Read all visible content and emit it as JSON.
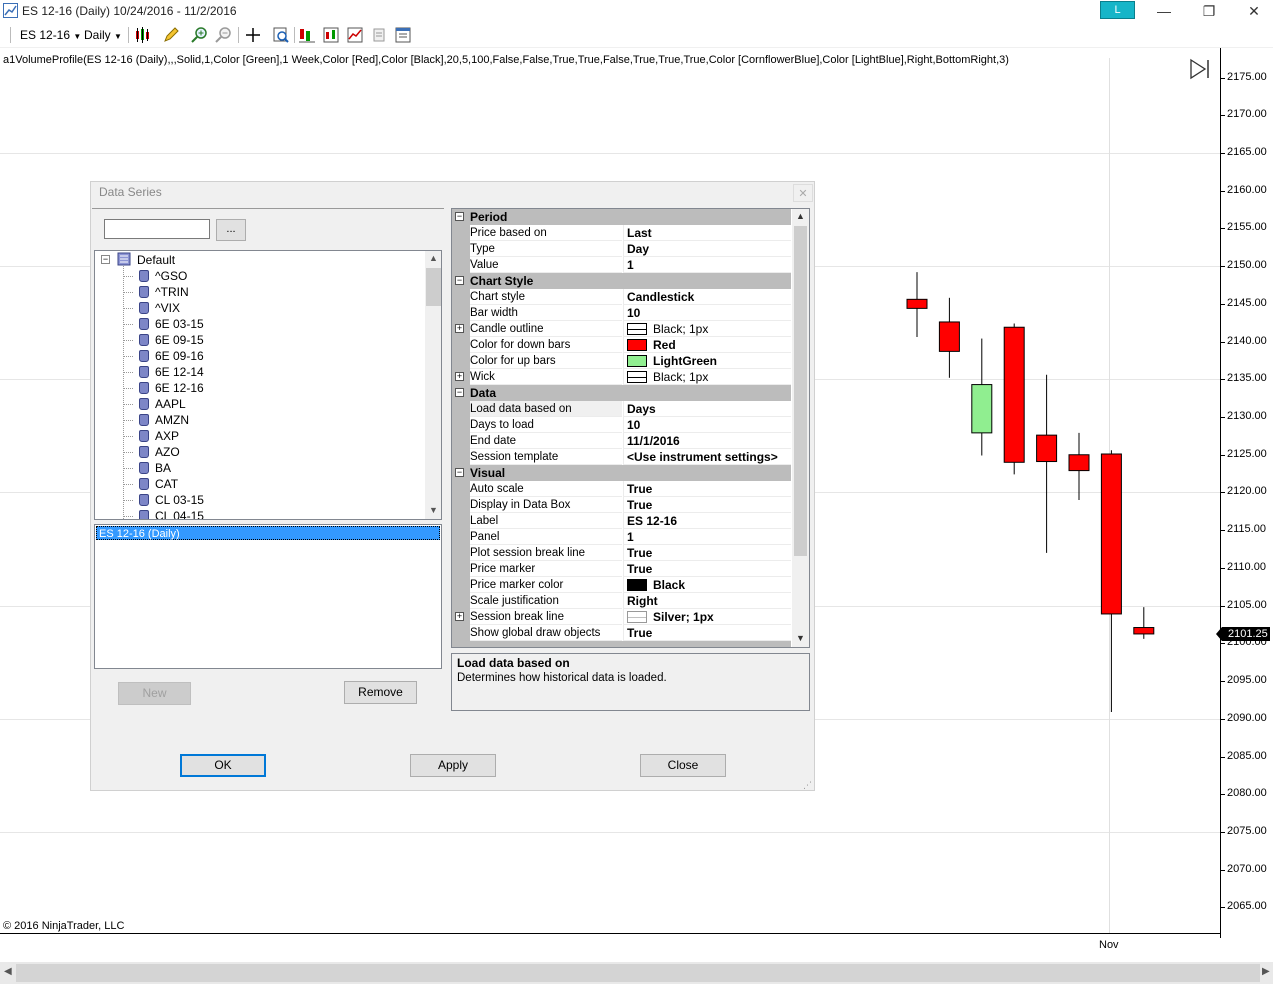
{
  "window": {
    "title": "ES 12-16 (Daily)  10/24/2016 - 11/2/2016",
    "badge": "L",
    "minimize": "—",
    "restore": "❐",
    "close": "✕"
  },
  "toolbar": {
    "instrument": "ES 12-16",
    "interval": "Daily"
  },
  "chart": {
    "indicator_label": "a1VolumeProfile(ES 12-16  (Daily),,,Solid,1,Color  [Green],1  Week,Color  [Red],Color  [Black],20,5,100,False,False,True,True,False,True,True,True,Color  [CornflowerBlue],Color  [LightBlue],Right,BottomRight,3)",
    "y_labels": [
      "2175.00",
      "2170.00",
      "2165.00",
      "2160.00",
      "2155.00",
      "2150.00",
      "2145.00",
      "2140.00",
      "2135.00",
      "2130.00",
      "2125.00",
      "2120.00",
      "2115.00",
      "2110.00",
      "2105.00",
      "2100.00",
      "2095.00",
      "2090.00",
      "2085.00",
      "2080.00",
      "2075.00",
      "2070.00",
      "2065.00"
    ],
    "price_marker": "2101.25",
    "x_label": "Nov",
    "copyright": "© 2016 NinjaTrader, LLC",
    "colors": {
      "down": "#ff0000",
      "up": "#90ee90",
      "wick": "#000000"
    },
    "candles": [
      {
        "open": 2145.6,
        "high": 2149.2,
        "low": 2140.6,
        "close": 2144.4
      },
      {
        "open": 2142.6,
        "high": 2145.8,
        "low": 2135.2,
        "close": 2138.7
      },
      {
        "open": 2127.9,
        "high": 2140.4,
        "low": 2124.9,
        "close": 2134.3
      },
      {
        "open": 2141.9,
        "high": 2142.4,
        "low": 2122.4,
        "close": 2124.0
      },
      {
        "open": 2127.6,
        "high": 2135.6,
        "low": 2112.0,
        "close": 2124.1
      },
      {
        "open": 2125.0,
        "high": 2127.9,
        "low": 2119.0,
        "close": 2122.9
      },
      {
        "open": 2125.1,
        "high": 2125.6,
        "low": 2090.9,
        "close": 2103.9
      },
      {
        "open": 2102.1,
        "high": 2104.8,
        "low": 2100.6,
        "close": 2101.25
      }
    ]
  },
  "dialog": {
    "title": "Data Series",
    "close": "✕",
    "search_value": "",
    "search_button": "...",
    "tree_root": "Default",
    "instruments": [
      "^GSO",
      "^TRIN",
      "^VIX",
      "6E 03-15",
      "6E 09-15",
      "6E 09-16",
      "6E 12-14",
      "6E 12-16",
      "AAPL",
      "AMZN",
      "AXP",
      "AZO",
      "BA",
      "CAT",
      "CL 03-15",
      "CL 04-15"
    ],
    "selected_series": "ES 12-16 (Daily)",
    "buttons": {
      "new": "New",
      "remove": "Remove",
      "ok": "OK",
      "apply": "Apply",
      "close": "Close"
    },
    "properties": [
      {
        "kind": "cat",
        "label": "Period"
      },
      {
        "kind": "prop",
        "name": "Price based on",
        "value": "Last"
      },
      {
        "kind": "prop",
        "name": "Type",
        "value": "Day"
      },
      {
        "kind": "prop",
        "name": "Value",
        "value": "1"
      },
      {
        "kind": "cat",
        "label": "Chart Style"
      },
      {
        "kind": "prop",
        "name": "Chart style",
        "value": "Candlestick"
      },
      {
        "kind": "prop",
        "name": "Bar width",
        "value": "10"
      },
      {
        "kind": "prop",
        "name": "Candle outline",
        "value": "Black; 1px",
        "expand": true,
        "swatch": "line",
        "normal": true
      },
      {
        "kind": "prop",
        "name": "Color for down bars",
        "value": "Red",
        "swatch": "#ff0000"
      },
      {
        "kind": "prop",
        "name": "Color for up bars",
        "value": "LightGreen",
        "swatch": "#90ee90"
      },
      {
        "kind": "prop",
        "name": "Wick",
        "value": "Black; 1px",
        "expand": true,
        "swatch": "line",
        "normal": true
      },
      {
        "kind": "cat",
        "label": "Data"
      },
      {
        "kind": "prop",
        "name": "Load data based on",
        "value": "Days",
        "selected": true
      },
      {
        "kind": "prop",
        "name": "Days to load",
        "value": "10"
      },
      {
        "kind": "prop",
        "name": "End date",
        "value": "11/1/2016"
      },
      {
        "kind": "prop",
        "name": "Session template",
        "value": "<Use instrument settings>"
      },
      {
        "kind": "cat",
        "label": "Visual"
      },
      {
        "kind": "prop",
        "name": "Auto scale",
        "value": "True"
      },
      {
        "kind": "prop",
        "name": "Display in Data Box",
        "value": "True"
      },
      {
        "kind": "prop",
        "name": "Label",
        "value": "ES 12-16"
      },
      {
        "kind": "prop",
        "name": "Panel",
        "value": "1"
      },
      {
        "kind": "prop",
        "name": "Plot session break line",
        "value": "True"
      },
      {
        "kind": "prop",
        "name": "Price marker",
        "value": "True"
      },
      {
        "kind": "prop",
        "name": "Price marker color",
        "value": "Black",
        "swatch": "#000000"
      },
      {
        "kind": "prop",
        "name": "Scale justification",
        "value": "Right"
      },
      {
        "kind": "prop",
        "name": "Session break line",
        "value": "Silver; 1px",
        "expand": true,
        "swatch": "silverline"
      },
      {
        "kind": "prop",
        "name": "Show global draw objects",
        "value": "True"
      }
    ],
    "description": {
      "title": "Load data based on",
      "text": "Determines how historical data is loaded."
    }
  }
}
